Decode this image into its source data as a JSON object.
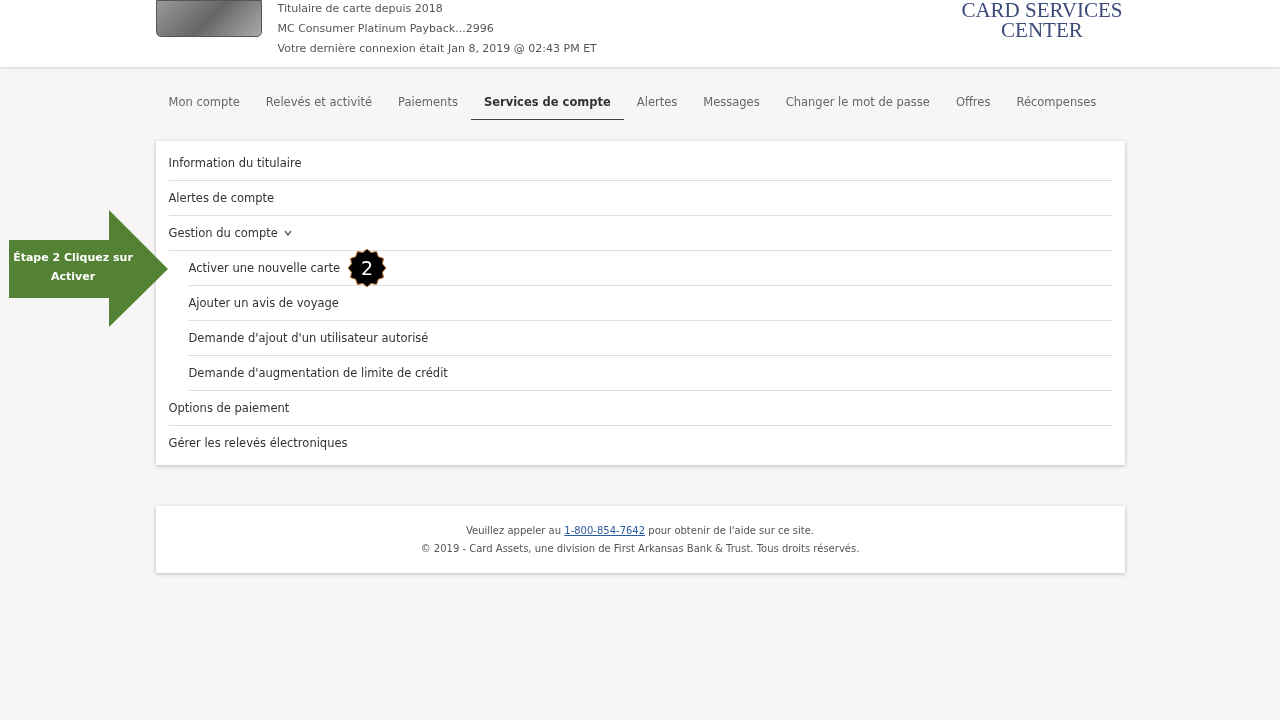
{
  "header": {
    "card_lines": [
      "Titulaire de carte depuis 2018",
      "MC Consumer Platinum Payback...2996",
      "Votre dernière connexion était Jan 8, 2019 @ 02:43 PM ET"
    ],
    "logo_lines": [
      "CARD SERVICES",
      "CENTER"
    ]
  },
  "tabs": [
    {
      "label": "Mon compte",
      "selected": false
    },
    {
      "label": "Relevés et activité",
      "selected": false
    },
    {
      "label": "Paiements",
      "selected": false
    },
    {
      "label": "Services de compte",
      "selected": true
    },
    {
      "label": "Alertes",
      "selected": false
    },
    {
      "label": "Messages",
      "selected": false
    },
    {
      "label": "Changer le mot de passe",
      "selected": false
    },
    {
      "label": "Offres",
      "selected": false
    },
    {
      "label": "Récompenses",
      "selected": false
    }
  ],
  "menu": {
    "items": [
      {
        "label": "Information du titulaire"
      },
      {
        "label": "Alertes de compte"
      },
      {
        "label": "Gestion du compte",
        "expanded": true,
        "children": [
          {
            "label": "Activer une nouvelle carte",
            "badge": "2"
          },
          {
            "label": "Ajouter un avis de voyage"
          },
          {
            "label": "Demande d'ajout d'un utilisateur autorisé"
          },
          {
            "label": "Demande d'augmentation de limite de crédit"
          }
        ]
      },
      {
        "label": "Options de paiement"
      },
      {
        "label": "Gérer les relevés électroniques"
      }
    ]
  },
  "callout": {
    "text": "Étape 2 Cliquez sur Activer"
  },
  "footer": {
    "help_before": "Veuillez appeler au",
    "phone": "1-800-854-7642",
    "help_after": "pour obtenir de l'aide sur ce site.",
    "copyright": "© 2019 - Card Assets, une division de First Arkansas Bank & Trust. Tous droits réservés."
  }
}
